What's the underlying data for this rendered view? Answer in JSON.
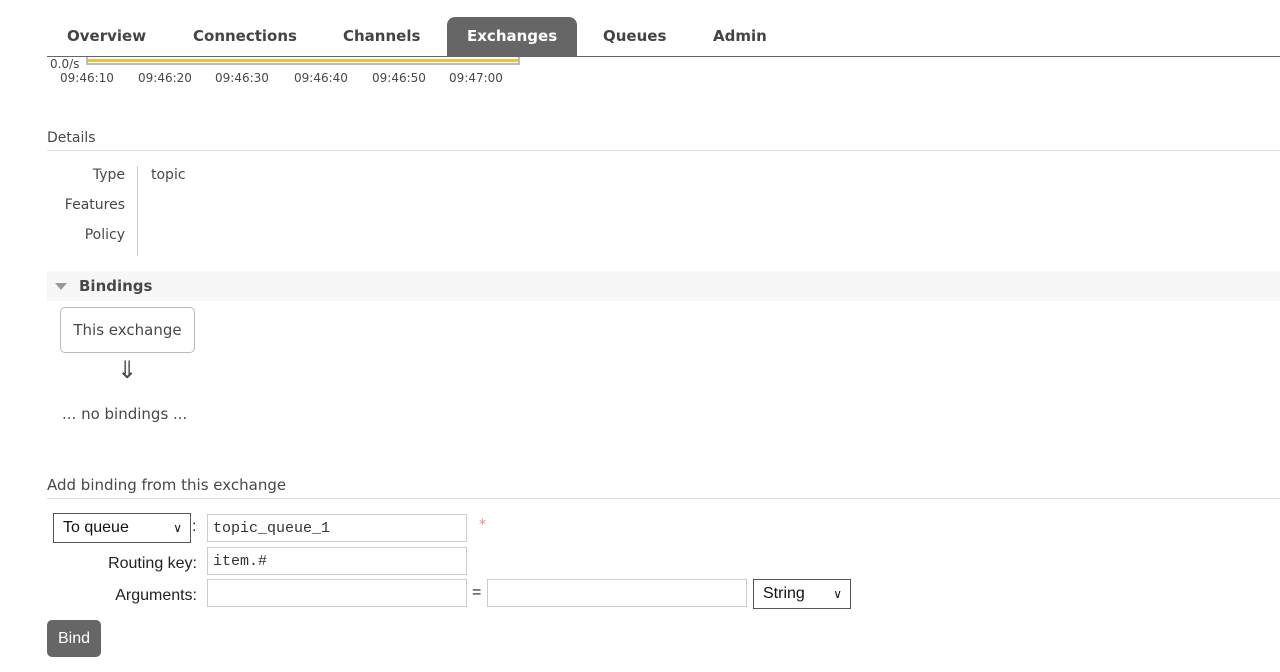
{
  "tabs": [
    "Overview",
    "Connections",
    "Channels",
    "Exchanges",
    "Queues",
    "Admin"
  ],
  "active_tab": "Exchanges",
  "chart": {
    "y_label": "0.0/s",
    "x_ticks": [
      "09:46:10",
      "09:46:20",
      "09:46:30",
      "09:46:40",
      "09:46:50",
      "09:47:00"
    ],
    "line_color": "#edc240"
  },
  "details": {
    "title": "Details",
    "rows": [
      {
        "label": "Type",
        "value": "topic"
      },
      {
        "label": "Features",
        "value": ""
      },
      {
        "label": "Policy",
        "value": ""
      }
    ]
  },
  "bindings": {
    "title": "Bindings",
    "source": "This exchange",
    "arrow": "⇓",
    "empty": "... no bindings ..."
  },
  "add_binding": {
    "title": "Add binding from this exchange",
    "destination_type": "To queue",
    "destination": "topic_queue_1",
    "required_mark": "*",
    "routing_key_label": "Routing key:",
    "routing_key": "item.#",
    "arguments_label": "Arguments:",
    "equals": "=",
    "arg_type": "String",
    "bind_label": "Bind"
  }
}
